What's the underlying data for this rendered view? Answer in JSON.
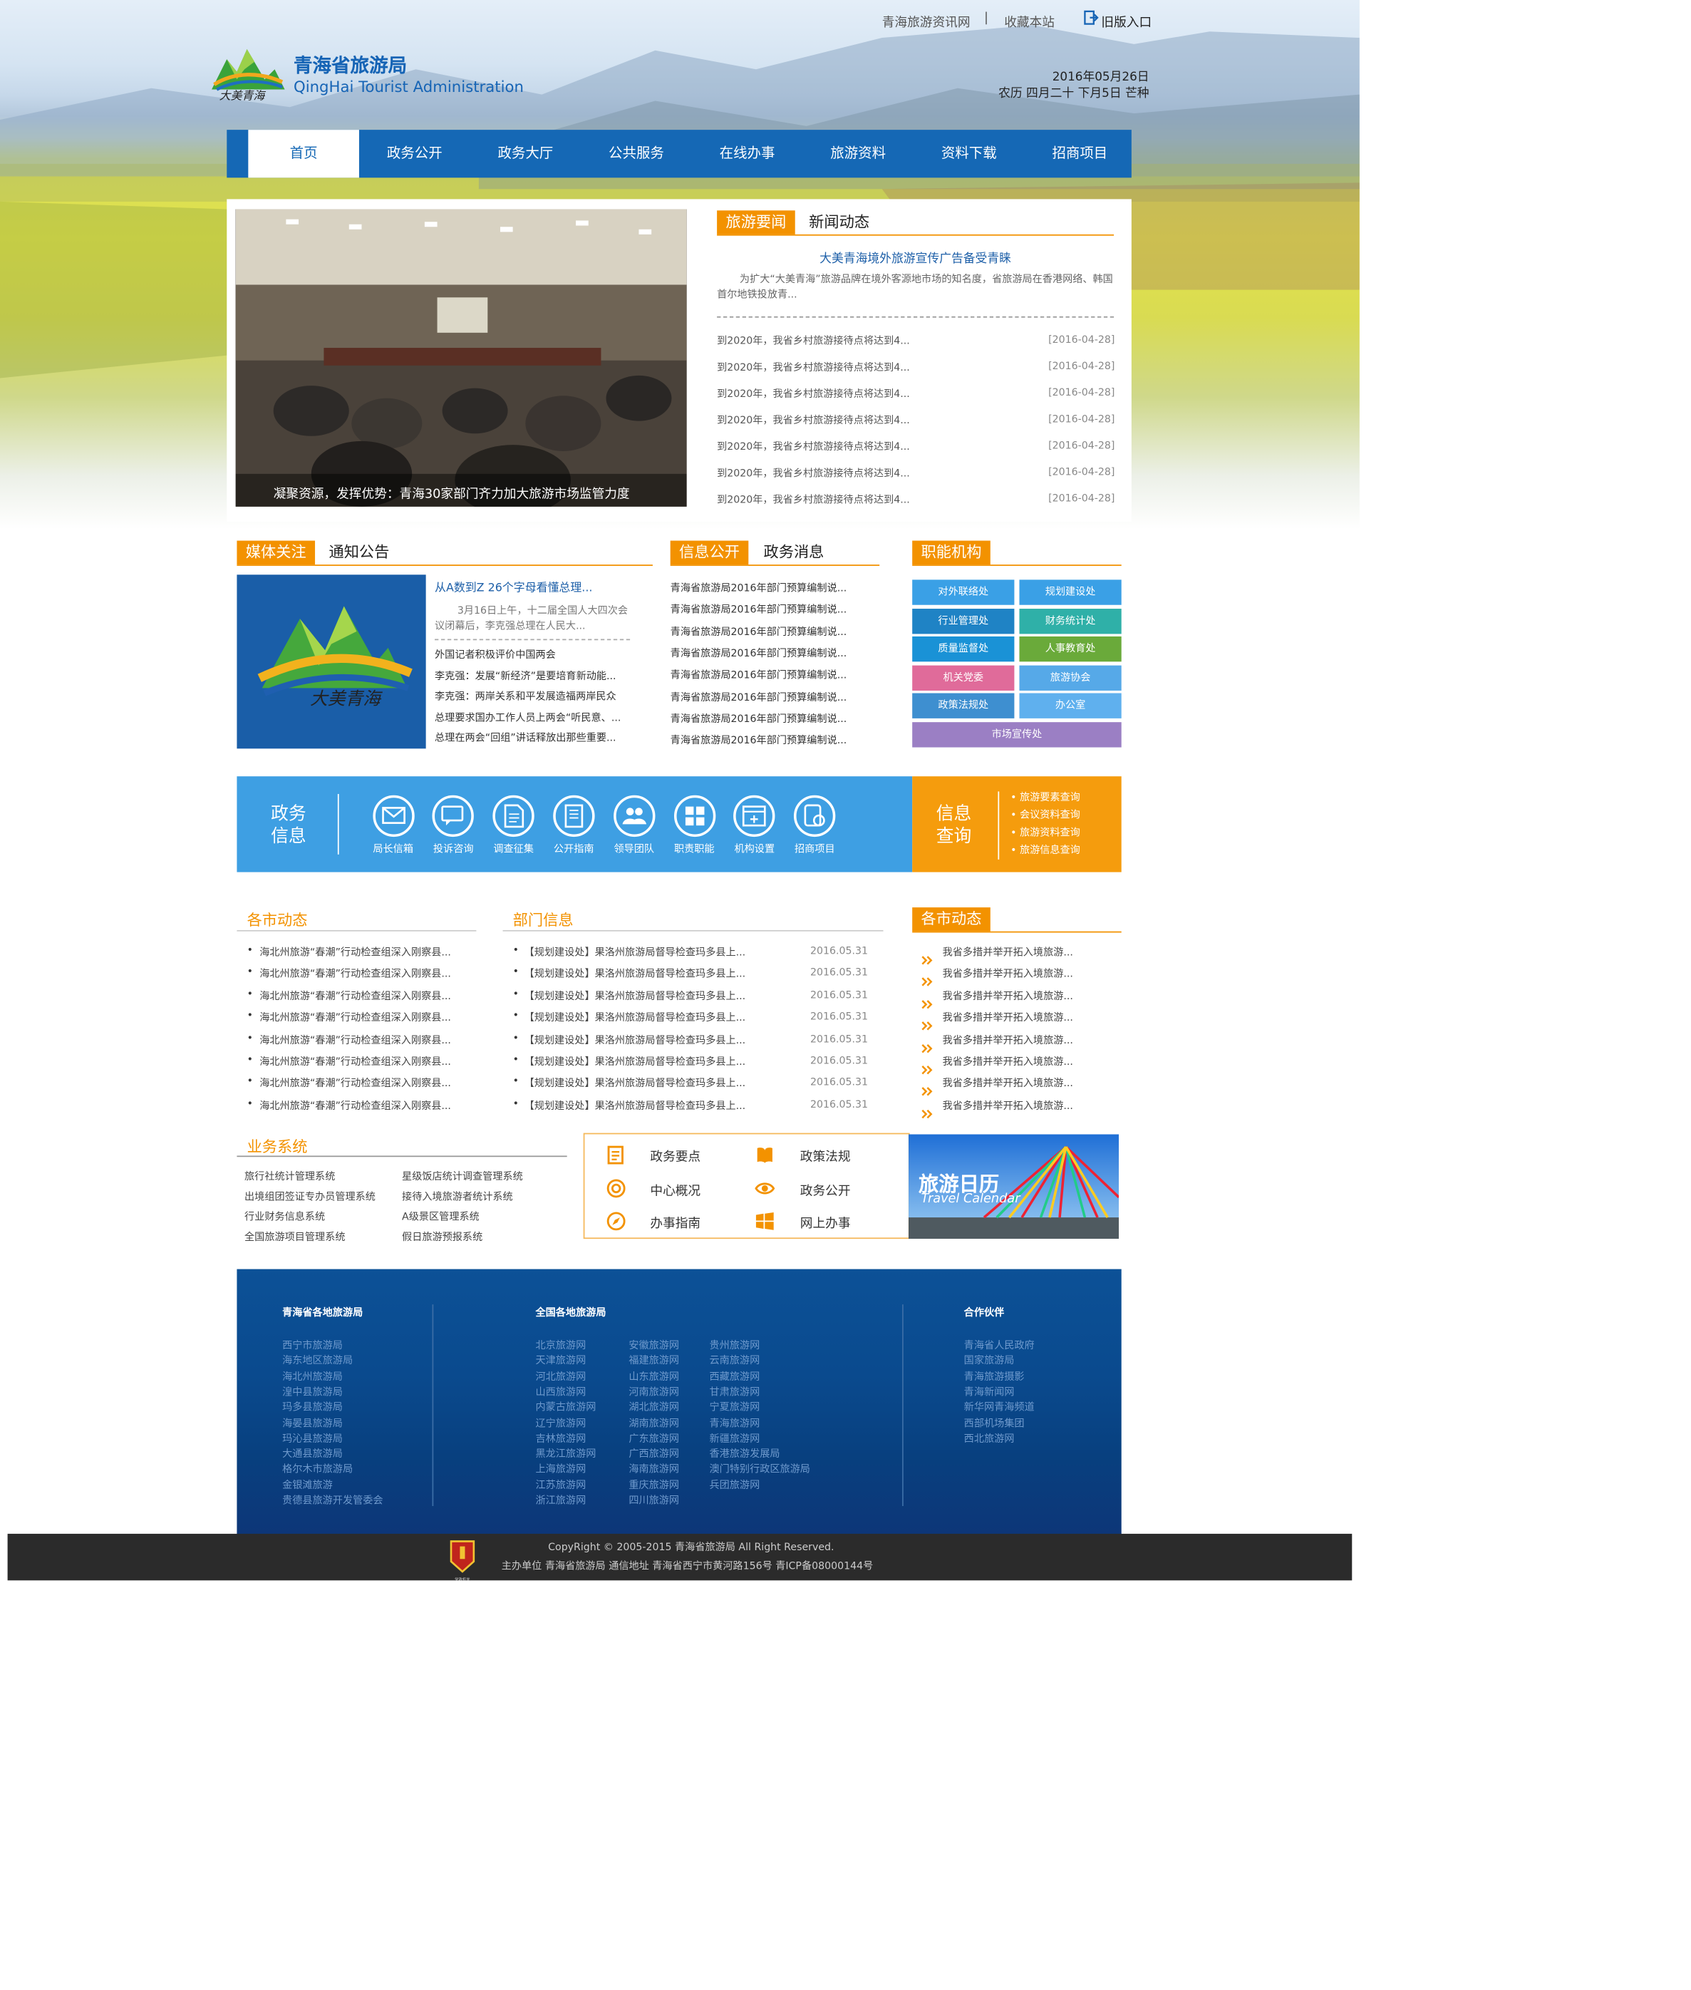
{
  "topbar": {
    "link1": "青海旅游资讯网",
    "sep": "|",
    "link2": "收藏本站",
    "link3": "旧版入口"
  },
  "logo": {
    "title": "青海省旅游局",
    "subtitle": "QingHai Tourist Administration",
    "mark": "大美青海"
  },
  "date": {
    "line1": "2016年05月26日",
    "line2": "农历 四月二十 下月5日 芒种"
  },
  "nav": [
    "首页",
    "政务公开",
    "政务大厅",
    "公共服务",
    "在线办事",
    "旅游资料",
    "资料下载",
    "招商项目"
  ],
  "slider": {
    "caption": "凝聚资源，发挥优势：青海30家部门齐力加大旅游市场监管力度"
  },
  "news": {
    "tab": "旅游要闻",
    "tab2": "新闻动态",
    "headline": "大美青海境外旅游宣传广告备受青睐",
    "summary": "为扩大“大美青海”旅游品牌在境外客源地市场的知名度，省旅游局在香港网络、韩国首尔地铁投放青...",
    "items": [
      {
        "title": "到2020年，我省乡村旅游接待点将达到4...",
        "date": "[2016-04-28]"
      },
      {
        "title": "到2020年，我省乡村旅游接待点将达到4...",
        "date": "[2016-04-28]"
      },
      {
        "title": "到2020年，我省乡村旅游接待点将达到4...",
        "date": "[2016-04-28]"
      },
      {
        "title": "到2020年，我省乡村旅游接待点将达到4...",
        "date": "[2016-04-28]"
      },
      {
        "title": "到2020年，我省乡村旅游接待点将达到4...",
        "date": "[2016-04-28]"
      },
      {
        "title": "到2020年，我省乡村旅游接待点将达到4...",
        "date": "[2016-04-28]"
      },
      {
        "title": "到2020年，我省乡村旅游接待点将达到4...",
        "date": "[2016-04-28]"
      }
    ]
  },
  "media": {
    "tab": "媒体关注",
    "tab2": "通知公告",
    "headline": "从A数到Z 26个字母看懂总理...",
    "summary": "3月16日上午，十二届全国人大四次会议闭幕后，李克强总理在人民大...",
    "items": [
      "外国记者积极评价中国两会",
      "李克强：发展“新经济”是要培育新动能...",
      "李克强：两岸关系和平发展造福两岸民众",
      "总理要求国办工作人员上两会“听民意、...",
      "总理在两会“回组”讲话释放出那些重要..."
    ]
  },
  "gov": {
    "tab": "信息公开",
    "tab2": "政务消息",
    "items": [
      "青海省旅游局2016年部门预算编制说...",
      "青海省旅游局2016年部门预算编制说...",
      "青海省旅游局2016年部门预算编制说...",
      "青海省旅游局2016年部门预算编制说...",
      "青海省旅游局2016年部门预算编制说...",
      "青海省旅游局2016年部门预算编制说...",
      "青海省旅游局2016年部门预算编制说...",
      "青海省旅游局2016年部门预算编制说..."
    ]
  },
  "org": {
    "tab": "职能机构",
    "buttons": [
      {
        "label": "对外联络处",
        "color": "#3aa0e6"
      },
      {
        "label": "规划建设处",
        "color": "#3aa0e6"
      },
      {
        "label": "行业管理处",
        "color": "#1f83c5"
      },
      {
        "label": "财务统计处",
        "color": "#2fb0a8"
      },
      {
        "label": "质量监督处",
        "color": "#1a92d6"
      },
      {
        "label": "人事教育处",
        "color": "#6aaa3a"
      },
      {
        "label": "机关党委",
        "color": "#e06b9a"
      },
      {
        "label": "旅游协会",
        "color": "#56a9e8"
      },
      {
        "label": "政策法规处",
        "color": "#3e8fd0"
      },
      {
        "label": "办公室",
        "color": "#5fb0ee"
      },
      {
        "label": "市场宣传处",
        "color": "#9b7fc4"
      }
    ]
  },
  "quickbar": {
    "title": "政务\n信息",
    "title1": "政务",
    "title2": "信息",
    "items": [
      {
        "label": "局长信箱",
        "icon": "mail-icon"
      },
      {
        "label": "投诉咨询",
        "icon": "chat-icon"
      },
      {
        "label": "调查征集",
        "icon": "doc-icon"
      },
      {
        "label": "公开指南",
        "icon": "book-icon"
      },
      {
        "label": "领导团队",
        "icon": "team-icon"
      },
      {
        "label": "职责职能",
        "icon": "grid-icon"
      },
      {
        "label": "机构设置",
        "icon": "window-icon"
      },
      {
        "label": "招商项目",
        "icon": "project-icon"
      }
    ],
    "query_title1": "信息",
    "query_title2": "查询",
    "query_items": [
      "旅游要素查询",
      "会议资料查询",
      "旅游资料查询",
      "旅游信息查询"
    ]
  },
  "city": {
    "tab": "各市动态",
    "items": [
      "海北州旅游“春潮”行动检查组深入刚察县...",
      "海北州旅游“春潮”行动检查组深入刚察县...",
      "海北州旅游“春潮”行动检查组深入刚察县...",
      "海北州旅游“春潮”行动检查组深入刚察县...",
      "海北州旅游“春潮”行动检查组深入刚察县...",
      "海北州旅游“春潮”行动检查组深入刚察县...",
      "海北州旅游“春潮”行动检查组深入刚察县...",
      "海北州旅游“春潮”行动检查组深入刚察县..."
    ]
  },
  "dept": {
    "tab": "部门信息",
    "items": [
      {
        "title": "【规划建设处】果洛州旅游局督导检查玛多县上...",
        "date": "2016.05.31"
      },
      {
        "title": "【规划建设处】果洛州旅游局督导检查玛多县上...",
        "date": "2016.05.31"
      },
      {
        "title": "【规划建设处】果洛州旅游局督导检查玛多县上...",
        "date": "2016.05.31"
      },
      {
        "title": "【规划建设处】果洛州旅游局督导检查玛多县上...",
        "date": "2016.05.31"
      },
      {
        "title": "【规划建设处】果洛州旅游局督导检查玛多县上...",
        "date": "2016.05.31"
      },
      {
        "title": "【规划建设处】果洛州旅游局督导检查玛多县上...",
        "date": "2016.05.31"
      },
      {
        "title": "【规划建设处】果洛州旅游局督导检查玛多县上...",
        "date": "2016.05.31"
      },
      {
        "title": "【规划建设处】果洛州旅游局督导检查玛多县上...",
        "date": "2016.05.31"
      }
    ]
  },
  "city2": {
    "tab": "各市动态",
    "items": [
      "我省多措并举开拓入境旅游...",
      "我省多措并举开拓入境旅游...",
      "我省多措并举开拓入境旅游...",
      "我省多措并举开拓入境旅游...",
      "我省多措并举开拓入境旅游...",
      "我省多措并举开拓入境旅游...",
      "我省多措并举开拓入境旅游...",
      "我省多措并举开拓入境旅游..."
    ]
  },
  "biz": {
    "tab": "业务系统",
    "items": [
      "旅行社统计管理系统",
      "星级饭店统计调查管理系统",
      "出境组团签证专办员管理系统",
      "接待入境旅游者统计系统",
      "行业财务信息系统",
      "A级景区管理系统",
      "全国旅游项目管理系统",
      "假日旅游预报系统"
    ]
  },
  "links": [
    "政务要点",
    "政策法规",
    "中心概况",
    "政务公开",
    "办事指南",
    "网上办事"
  ],
  "calendar": {
    "title": "旅游日历",
    "subtitle": "Travel Calendar"
  },
  "footer": {
    "col1": {
      "title": "青海省各地旅游局",
      "items": [
        "西宁市旅游局",
        "海东地区旅游局",
        "海北州旅游局",
        "湟中县旅游局",
        "玛多县旅游局",
        "海晏县旅游局",
        "玛沁县旅游局",
        "大通县旅游局",
        "格尔木市旅游局",
        "金银滩旅游",
        "贵德县旅游开发管委会"
      ]
    },
    "col2": {
      "title": "全国各地旅游局",
      "a": [
        "北京旅游网",
        "天津旅游网",
        "河北旅游网",
        "山西旅游网",
        "内蒙古旅游网",
        "辽宁旅游网",
        "吉林旅游网",
        "黑龙江旅游网",
        "上海旅游网",
        "江苏旅游网",
        "浙江旅游网"
      ],
      "b": [
        "安徽旅游网",
        "福建旅游网",
        "山东旅游网",
        "河南旅游网",
        "湖北旅游网",
        "湖南旅游网",
        "广东旅游网",
        "广西旅游网",
        "海南旅游网",
        "重庆旅游网",
        "四川旅游网"
      ],
      "c": [
        "贵州旅游网",
        "云南旅游网",
        "西藏旅游网",
        "甘肃旅游网",
        "宁夏旅游网",
        "青海旅游网",
        "新疆旅游网",
        "香港旅游发展局",
        "澳门特别行政区旅游局",
        "兵团旅游网"
      ]
    },
    "col3": {
      "title": "合作伙伴",
      "items": [
        "青海省人民政府",
        "国家旅游局",
        "青海旅游摄影",
        "青海新闻网",
        "新华网青海频道",
        "西部机场集团",
        "西北旅游网"
      ]
    }
  },
  "copyright": {
    "line1": "CopyRight © 2005-2015 青海省旅游局 All Right Reserved.",
    "line2": "主办单位 青海省旅游局 通信地址 青海省西宁市黄河路156号 青ICP备08000144号",
    "badge": "党政机关"
  }
}
